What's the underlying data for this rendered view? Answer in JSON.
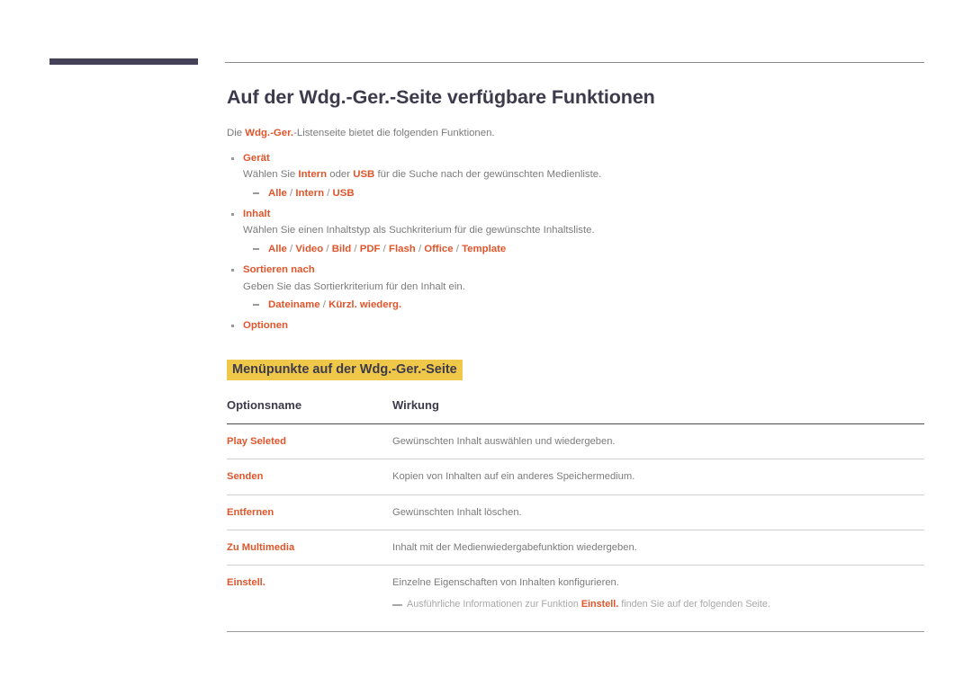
{
  "page": {
    "title": "Auf der Wdg.-Ger.-Seite verfügbare Funktionen",
    "intro_before": "Die ",
    "intro_accent": "Wdg.-Ger.",
    "intro_after": "-Listenseite bietet die folgenden Funktionen."
  },
  "colors": {
    "accent": "#e0552b",
    "highlight": "#efc84a",
    "dark": "#3d3a4c",
    "body_text": "#7b7b7b",
    "deco_bar": "#454158"
  },
  "bullets": [
    {
      "label": "Gerät",
      "desc_parts": [
        {
          "text": "Wählen Sie ",
          "accent": false
        },
        {
          "text": "Intern",
          "accent": true
        },
        {
          "text": " oder ",
          "accent": false
        },
        {
          "text": "USB",
          "accent": true
        },
        {
          "text": " für die Suche nach der gewünschten Medienliste.",
          "accent": false
        }
      ],
      "options": [
        "Alle",
        "Intern",
        "USB"
      ]
    },
    {
      "label": "Inhalt",
      "desc_parts": [
        {
          "text": "Wählen Sie einen Inhaltstyp als Suchkriterium für die gewünschte Inhaltsliste.",
          "accent": false
        }
      ],
      "options": [
        "Alle",
        "Video",
        "Bild",
        "PDF",
        "Flash",
        "Office",
        "Template"
      ]
    },
    {
      "label": "Sortieren nach",
      "desc_parts": [
        {
          "text": "Geben Sie das Sortierkriterium für den Inhalt ein.",
          "accent": false
        }
      ],
      "options": [
        "Dateiname",
        "Kürzl. wiederg."
      ]
    },
    {
      "label": "Optionen",
      "desc_parts": [],
      "options": []
    }
  ],
  "section_heading": "Menüpunkte auf der Wdg.-Ger.-Seite",
  "table": {
    "headers": [
      "Optionsname",
      "Wirkung"
    ],
    "rows": [
      {
        "name": "Play Seleted",
        "effect": "Gewünschten Inhalt auswählen und wiedergeben."
      },
      {
        "name": "Senden",
        "effect": "Kopien von Inhalten auf ein anderes Speichermedium."
      },
      {
        "name": "Entfernen",
        "effect": "Gewünschten Inhalt löschen."
      },
      {
        "name": "Zu Multimedia",
        "effect": "Inhalt mit der Medienwiedergabefunktion wiedergeben."
      },
      {
        "name": "Einstell.",
        "effect": "Einzelne Eigenschaften von Inhalten konfigurieren."
      }
    ],
    "note": {
      "before": "Ausführliche Informationen zur Funktion ",
      "accent": "Einstell.",
      "after": " finden Sie auf der folgenden Seite."
    }
  }
}
